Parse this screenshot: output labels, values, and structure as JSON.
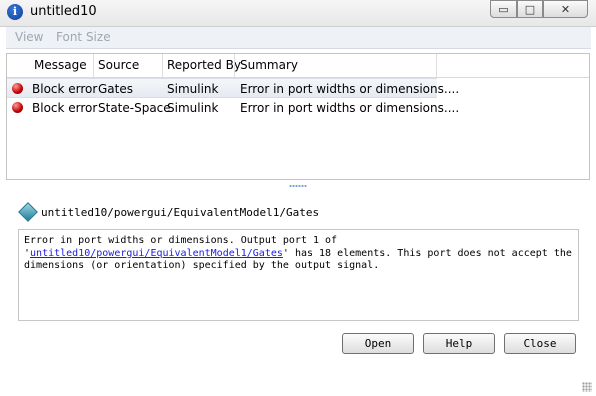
{
  "window": {
    "title": "untitled10",
    "min_glyph": "▭",
    "max_glyph": "□",
    "close_glyph": "✕",
    "app_icon_glyph": "i"
  },
  "menubar": {
    "items": [
      "View",
      "Font Size"
    ]
  },
  "table": {
    "columns": [
      "Message",
      "Source",
      "Reported By",
      "Summary"
    ],
    "rows": [
      {
        "message": "Block error",
        "source": "Gates",
        "reported_by": "Simulink",
        "summary": "Error in port widths or dimensions...."
      },
      {
        "message": "Block error",
        "source": "State-Space",
        "reported_by": "Simulink",
        "summary": "Error in port widths or dimensions...."
      }
    ]
  },
  "detail": {
    "path": "untitled10/powergui/EquivalentModel1/Gates",
    "text_before": "Error in port widths or dimensions. Output port 1 of",
    "link_open_quote": "'",
    "link": "untitled10/powergui/EquivalentModel1/Gates",
    "text_after": "' has 18 elements. This port does not accept the dimensions (or orientation) specified by the output signal."
  },
  "buttons": {
    "open": "Open",
    "help": "Help",
    "close": "Close"
  }
}
